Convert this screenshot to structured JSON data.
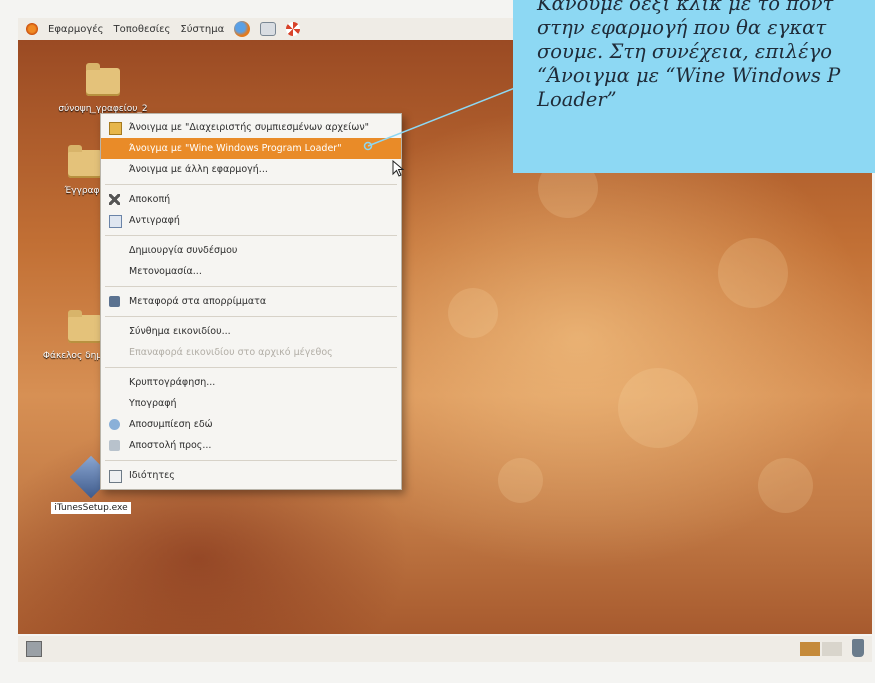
{
  "top_panel": {
    "menus": [
      "Εφαρμογές",
      "Τοποθεσίες",
      "Σύστημα"
    ]
  },
  "desktop_icons": [
    {
      "label": "σύνοψη_γραφείου_2",
      "type": "folder"
    },
    {
      "label": "Έγγραφα",
      "type": "folder"
    },
    {
      "label": "Φάκελος δημόσιος",
      "type": "folder"
    },
    {
      "label": "iTunesSetup.exe",
      "type": "exe"
    }
  ],
  "context_menu": {
    "groups": [
      [
        {
          "label": "Άνοιγμα με \"Διαχειριστής συμπιεσμένων αρχείων\"",
          "icon": "archive-icon",
          "highlighted": false,
          "disabled": false
        },
        {
          "label": "Άνοιγμα με \"Wine Windows Program Loader\"",
          "icon": "",
          "highlighted": true,
          "disabled": false
        },
        {
          "label": "Άνοιγμα με άλλη εφαρμογή...",
          "icon": "",
          "highlighted": false,
          "disabled": false
        }
      ],
      [
        {
          "label": "Αποκοπή",
          "icon": "scissors-icon",
          "highlighted": false,
          "disabled": false
        },
        {
          "label": "Αντιγραφή",
          "icon": "copy-icon",
          "highlighted": false,
          "disabled": false
        }
      ],
      [
        {
          "label": "Δημιουργία συνδέσμου",
          "icon": "",
          "highlighted": false,
          "disabled": false
        },
        {
          "label": "Μετονομασία...",
          "icon": "",
          "highlighted": false,
          "disabled": false
        }
      ],
      [
        {
          "label": "Μεταφορά στα απορρίμματα",
          "icon": "trash-icon",
          "highlighted": false,
          "disabled": false
        }
      ],
      [
        {
          "label": "Σύνθημα εικονιδίου...",
          "icon": "",
          "highlighted": false,
          "disabled": false
        },
        {
          "label": "Επαναφορά εικονιδίου στο αρχικό μέγεθος",
          "icon": "",
          "highlighted": false,
          "disabled": true
        }
      ],
      [
        {
          "label": "Κρυπτογράφηση...",
          "icon": "",
          "highlighted": false,
          "disabled": false
        },
        {
          "label": "Υπογραφή",
          "icon": "",
          "highlighted": false,
          "disabled": false
        },
        {
          "label": "Αποσυμπίεση εδώ",
          "icon": "extract-icon",
          "highlighted": false,
          "disabled": false
        },
        {
          "label": "Αποστολή προς...",
          "icon": "send-icon",
          "highlighted": false,
          "disabled": false
        }
      ],
      [
        {
          "label": "Ιδιότητες",
          "icon": "properties-icon",
          "highlighted": false,
          "disabled": false
        }
      ]
    ]
  },
  "callout": {
    "text": "Κάνουμε δεξί κλικ με το ποντ\nστην εφαρμογή που θα εγκατ\nσουμε. Στη συνέχεια, επιλέγο\n“Άνοιγμα με “Wine Windows P\nLoader”"
  },
  "colors": {
    "highlight": "#e98b28",
    "callout_bg": "#8dd8f3",
    "panel_bg": "#efece6"
  }
}
